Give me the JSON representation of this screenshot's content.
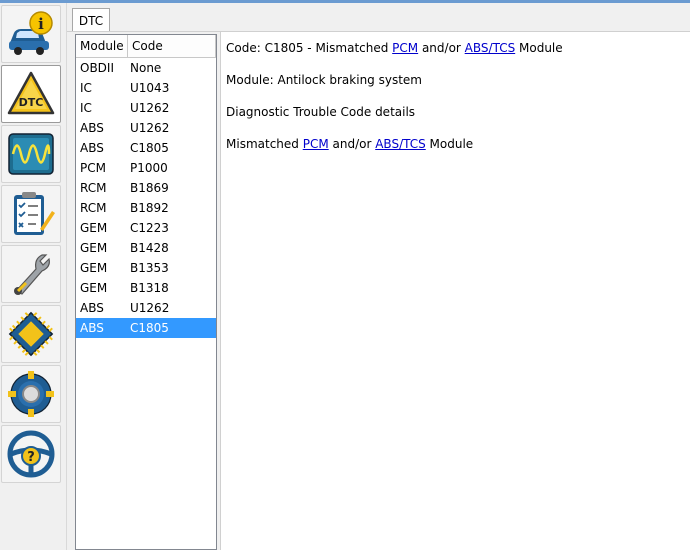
{
  "toolbar": {
    "tools": [
      {
        "name": "vehicle-info",
        "icon": "car-info-icon"
      },
      {
        "name": "dtc",
        "icon": "dtc-warning-icon",
        "label": "DTC",
        "active": true
      },
      {
        "name": "oscilloscope",
        "icon": "oscilloscope-icon"
      },
      {
        "name": "checklist",
        "icon": "checklist-icon"
      },
      {
        "name": "service",
        "icon": "wrench-icon"
      },
      {
        "name": "module",
        "icon": "chip-icon"
      },
      {
        "name": "settings",
        "icon": "gear-icon"
      },
      {
        "name": "help",
        "icon": "steering-wheel-help-icon",
        "label": "?"
      }
    ]
  },
  "tabs": [
    {
      "label": "DTC",
      "active": true
    }
  ],
  "list": {
    "columns": [
      "Module",
      "Code"
    ],
    "rows": [
      {
        "module": "OBDII",
        "code": "None"
      },
      {
        "module": "IC",
        "code": "U1043"
      },
      {
        "module": "IC",
        "code": "U1262"
      },
      {
        "module": "ABS",
        "code": "U1262"
      },
      {
        "module": "ABS",
        "code": "C1805"
      },
      {
        "module": "PCM",
        "code": "P1000"
      },
      {
        "module": "RCM",
        "code": "B1869"
      },
      {
        "module": "RCM",
        "code": "B1892"
      },
      {
        "module": "GEM",
        "code": "C1223"
      },
      {
        "module": "GEM",
        "code": "B1428"
      },
      {
        "module": "GEM",
        "code": "B1353"
      },
      {
        "module": "GEM",
        "code": "B1318"
      },
      {
        "module": "ABS",
        "code": "U1262"
      },
      {
        "module": "ABS",
        "code": "C1805",
        "selected": true
      }
    ]
  },
  "detail": {
    "code_prefix": "Code: C1805 - Mismatched ",
    "link_pcm": "PCM",
    "and_or": " and/or ",
    "link_abs_tcs": "ABS/TCS",
    "module_suffix": " Module",
    "module_line": "Module: Antilock braking system",
    "details_heading": "Diagnostic Trouble Code details",
    "desc_prefix": "Mismatched "
  },
  "colors": {
    "selection": "#3399ff",
    "link": "#0000cc",
    "accent": "#6b9bd1"
  }
}
